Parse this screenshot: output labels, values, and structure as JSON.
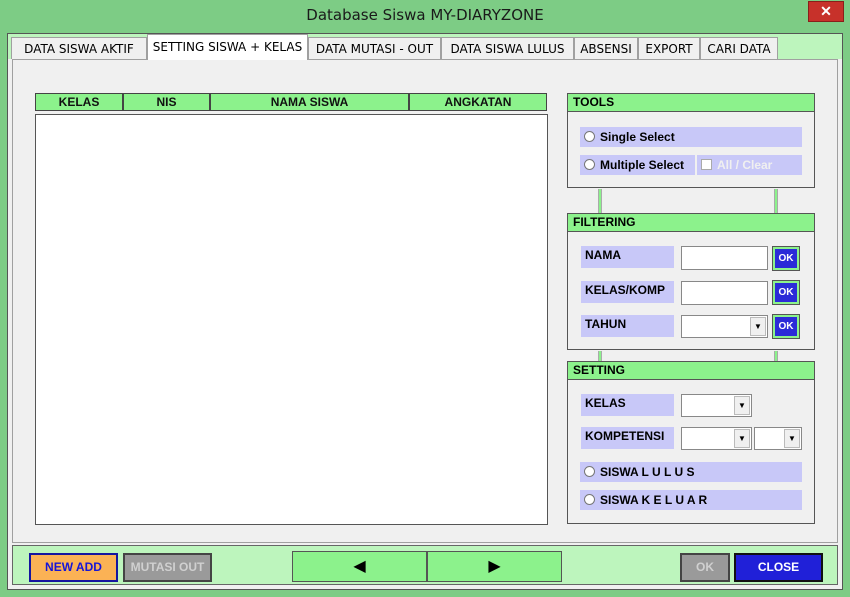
{
  "window": {
    "title": "Database Siswa MY-DIARYZONE",
    "close_glyph": "✕"
  },
  "tabs": [
    {
      "label": "DATA SISWA AKTIF"
    },
    {
      "label": "SETTING SISWA + KELAS"
    },
    {
      "label": "DATA MUTASI - OUT"
    },
    {
      "label": "DATA SISWA LULUS"
    },
    {
      "label": "ABSENSI"
    },
    {
      "label": "EXPORT"
    },
    {
      "label": "CARI DATA"
    }
  ],
  "active_tab": "SETTING SISWA + KELAS",
  "list": {
    "columns": [
      "KELAS",
      "NIS",
      "NAMA SISWA",
      "ANGKATAN"
    ],
    "rows": []
  },
  "tools": {
    "title": "TOOLS",
    "single_select": "Single Select",
    "multiple_select": "Multiple Select",
    "all_clear": "All / Clear"
  },
  "filtering": {
    "title": "FILTERING",
    "nama_label": "NAMA",
    "kelas_komp_label": "KELAS/KOMP",
    "tahun_label": "TAHUN",
    "ok_label": "OK",
    "nama_value": "",
    "kelas_komp_value": "",
    "tahun_value": ""
  },
  "setting": {
    "title": "SETTING",
    "kelas_label": "KELAS",
    "kompetensi_label": "KOMPETENSI",
    "siswa_lulus": "SISWA L U L U S",
    "siswa_keluar": "SISWA K E L U A R"
  },
  "bottom": {
    "new_add": "NEW ADD",
    "mutasi_out": "MUTASI OUT",
    "prev_glyph": "◀",
    "next_glyph": "▶",
    "ok": "OK",
    "close": "CLOSE"
  },
  "colors": {
    "accent_green": "#8cf28c",
    "label_lavender": "#c8c8f8",
    "ok_blue": "#2b2bd8",
    "new_add_orange": "#fbb255",
    "close_blue": "#2020d8"
  }
}
